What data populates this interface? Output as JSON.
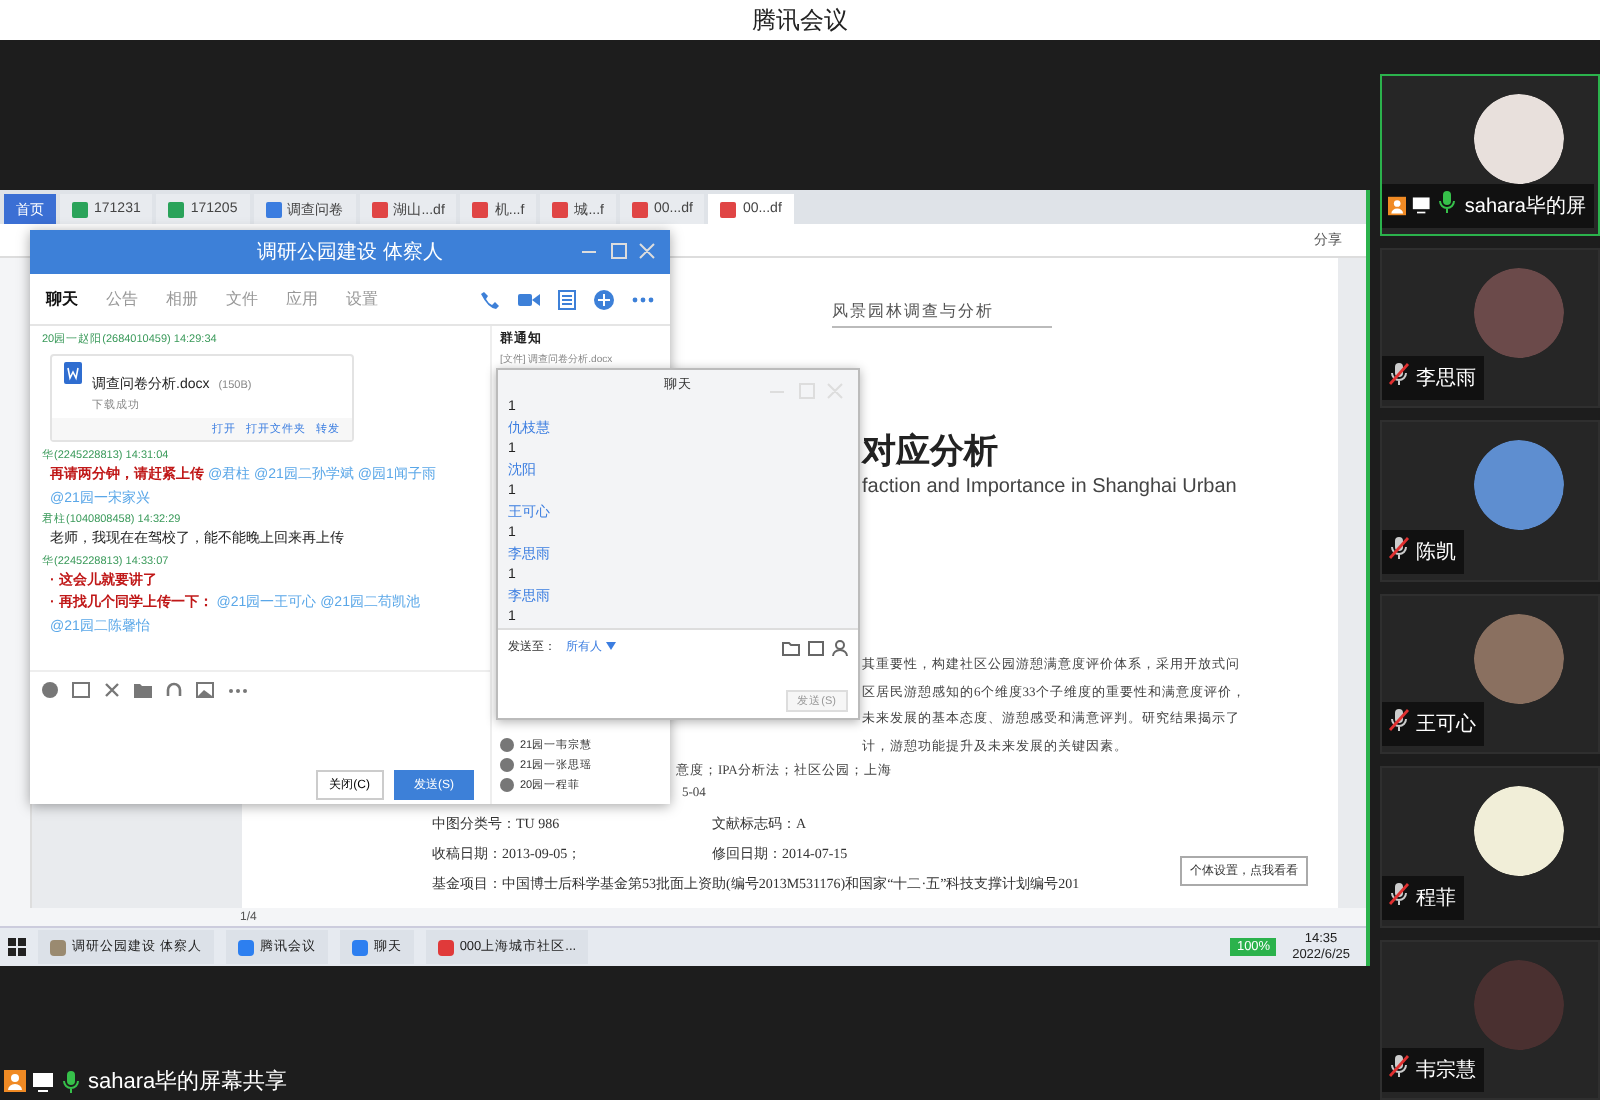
{
  "window": {
    "title": "腾讯会议"
  },
  "share": {
    "browser_tabs": [
      {
        "label": "首页",
        "kind": "home",
        "selected": false
      },
      {
        "label": "171231",
        "kind": "sheet",
        "selected": false
      },
      {
        "label": "171205",
        "kind": "sheet",
        "selected": false
      },
      {
        "label": "调查问卷",
        "kind": "doc",
        "selected": false
      },
      {
        "label": "湖山...df",
        "kind": "pdf",
        "selected": false
      },
      {
        "label": "机...f",
        "kind": "pdf",
        "selected": false
      },
      {
        "label": "城...f",
        "kind": "pdf",
        "selected": false
      },
      {
        "label": "00...df",
        "kind": "pdf",
        "selected": false
      },
      {
        "label": "00...df",
        "kind": "pdf",
        "selected": true
      }
    ],
    "toolbar": {
      "share_label": "分享"
    },
    "document": {
      "running_head": "风景园林调查与分析",
      "title": "对应分析",
      "english_title": "faction and Importance in Shanghai Urban",
      "abstract_lines": [
        "其重要性，构建社区公园游憩满意度评价体系，采用开放式问",
        "区居民游憩感知的6个维度33个子维度的重要性和满意度评价，",
        "未来发展的基本态度、游憩感受和满意评判。研究结果揭示了",
        "计，游憩功能提升及未来发展的关键因素。"
      ],
      "date_fragment": "5-04",
      "keywords": "意度；IPA分析法；社区公园；上海",
      "meta_rows": [
        [
          "中图分类号：TU 986",
          "文献标志码：A"
        ],
        [
          "收稿日期：2013-09-05；",
          "修回日期：2014-07-15"
        ],
        [
          "基金项目：中国博士后科学基金第53批面上资助(编号2013M531176)和国家“十二·五”科技支撑计划编号201"
        ]
      ],
      "page_counter": "1/4"
    },
    "tooltip": "个体设置，点我看看",
    "group_chat": {
      "title": "调研公园建设 体察人",
      "tabs": [
        {
          "label": "聊天",
          "selected": true
        },
        {
          "label": "公告",
          "selected": false
        },
        {
          "label": "相册",
          "selected": false
        },
        {
          "label": "文件",
          "selected": false
        },
        {
          "label": "应用",
          "selected": false
        },
        {
          "label": "设置",
          "selected": false
        }
      ],
      "messages": [
        {
          "kind": "file",
          "sender": "20园一赵阳(2684010459)",
          "time": "14:29:34",
          "file_name": "调查问卷分析.docx",
          "file_size": "(150B)",
          "file_status": "下载成功",
          "actions": [
            "打开",
            "打开文件夹",
            "转发"
          ]
        },
        {
          "kind": "text",
          "sender": "华(2245228813)",
          "time": "14:31:04",
          "lines": [
            [
              {
                "text": "再请两分钟，请赶紧上传",
                "kind": "alert"
              },
              {
                "text": "@君柱 @21园二孙学斌 @园1闻子雨",
                "kind": "mention"
              }
            ],
            [
              {
                "text": "@21园一宋家兴",
                "kind": "mention"
              }
            ]
          ]
        },
        {
          "kind": "text",
          "sender": "君柱(1040808458)",
          "time": "14:32:29",
          "lines": [
            [
              {
                "text": "老师，我现在在驾校了，能不能晚上回来再上传",
                "kind": "plain"
              }
            ]
          ]
        },
        {
          "kind": "text",
          "sender": "华(2245228813)",
          "time": "14:33:07",
          "lines": [
            [
              {
                "text": "· 这会儿就要讲了",
                "kind": "alert"
              }
            ],
            [
              {
                "text": "· 再找几个同学上传一下：",
                "kind": "alert"
              },
              {
                "text": "@21园一王可心 @21园二苟凯池",
                "kind": "mention"
              }
            ],
            [
              {
                "text": "@21园二陈馨怡",
                "kind": "mention"
              }
            ]
          ]
        }
      ],
      "notice_title": "群通知",
      "notice_file": "[文件] 调查问卷分析.docx",
      "members": [
        "21园一韦宗慧",
        "21园一张思瑶",
        "20园一程菲"
      ],
      "close_button": "关闭(C)",
      "send_button": "发送(S)"
    },
    "meeting_chat": {
      "title": "聊天",
      "entries": [
        {
          "kind": "text",
          "text": "1"
        },
        {
          "kind": "name",
          "text": "仇枝慧"
        },
        {
          "kind": "text",
          "text": "1"
        },
        {
          "kind": "name",
          "text": "沈阳"
        },
        {
          "kind": "text",
          "text": "1"
        },
        {
          "kind": "name",
          "text": "王可心"
        },
        {
          "kind": "text",
          "text": "1"
        },
        {
          "kind": "name",
          "text": "李思雨"
        },
        {
          "kind": "text",
          "text": "1"
        },
        {
          "kind": "name",
          "text": "李思雨"
        },
        {
          "kind": "text",
          "text": "1"
        }
      ],
      "send_to_label": "发送至：",
      "recipient": "所有人",
      "send_button": "发送(S)"
    },
    "taskbar": {
      "items": [
        {
          "label": "调研公园建设 体察人",
          "kind": "group"
        },
        {
          "label": "腾讯会议",
          "kind": "meeting"
        },
        {
          "label": "聊天",
          "kind": "meeting"
        },
        {
          "label": "000上海城市社区...",
          "kind": "wps"
        }
      ],
      "battery": "100%",
      "time": "14:35",
      "date": "2022/6/25"
    }
  },
  "participants": [
    {
      "name": "sahara毕的屏",
      "muted": false,
      "sharing": true,
      "active": true
    },
    {
      "name": "李思雨",
      "muted": true,
      "sharing": false,
      "active": false
    },
    {
      "name": "陈凯",
      "muted": true,
      "sharing": false,
      "active": false
    },
    {
      "name": "王可心",
      "muted": true,
      "sharing": false,
      "active": false
    },
    {
      "name": "程菲",
      "muted": true,
      "sharing": false,
      "active": false
    },
    {
      "name": "韦宗慧",
      "muted": true,
      "sharing": false,
      "active": false
    }
  ],
  "presenter_label": "sahara毕的屏幕共享"
}
